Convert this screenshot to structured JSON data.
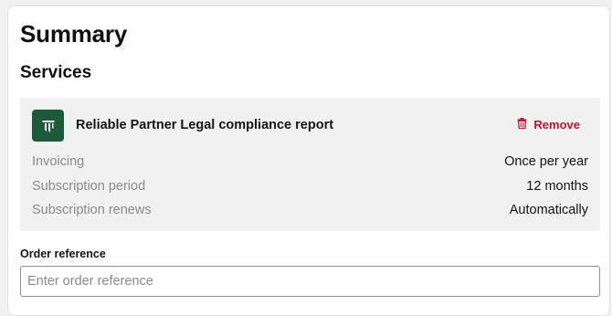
{
  "summary": {
    "title": "Summary",
    "services_heading": "Services"
  },
  "service": {
    "logo_icon": "partner-logo-icon",
    "name": "Reliable Partner Legal compliance report",
    "remove_label": "Remove",
    "remove_icon": "trash-icon",
    "remove_color": "#c8102e",
    "logo_color": "#1d5a3a",
    "details": [
      {
        "label": "Invoicing",
        "value": "Once per year"
      },
      {
        "label": "Subscription period",
        "value": "12 months"
      },
      {
        "label": "Subscription renews",
        "value": "Automatically"
      }
    ]
  },
  "order_reference": {
    "label": "Order reference",
    "placeholder": "Enter order reference",
    "value": ""
  }
}
